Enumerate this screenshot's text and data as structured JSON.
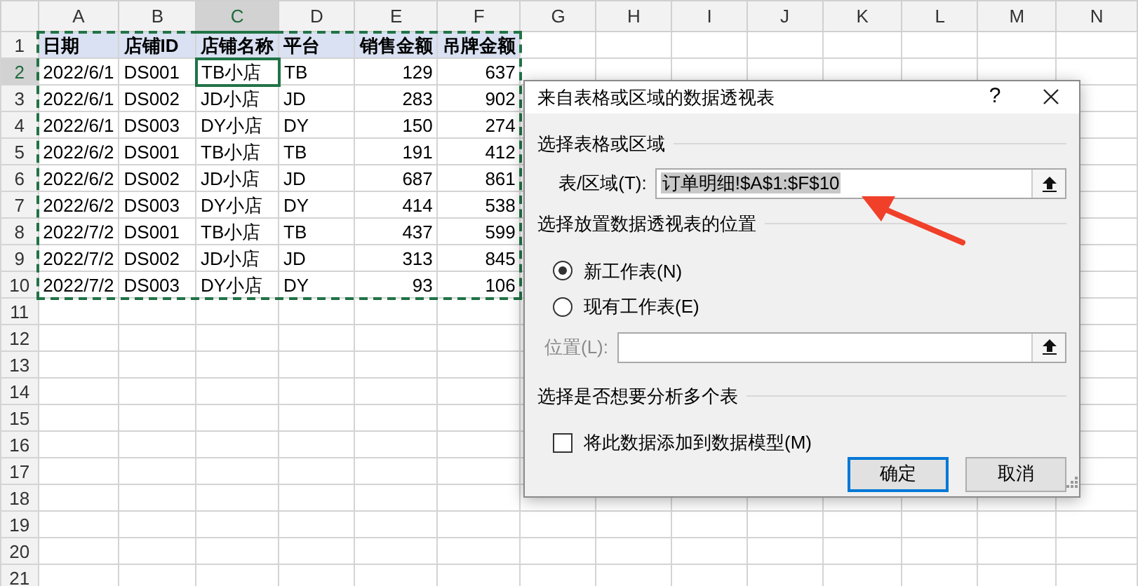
{
  "sheet": {
    "range_marquee": true,
    "columns": [
      {
        "label": "A",
        "kind": "date",
        "selected": false
      },
      {
        "label": "B",
        "kind": "text",
        "selected": false
      },
      {
        "label": "C",
        "kind": "text",
        "selected": true
      },
      {
        "label": "D",
        "kind": "text",
        "selected": false
      },
      {
        "label": "E",
        "kind": "number",
        "selected": false
      },
      {
        "label": "F",
        "kind": "number",
        "selected": false
      },
      {
        "label": "G",
        "selected": false
      },
      {
        "label": "H",
        "selected": false
      },
      {
        "label": "I",
        "selected": false
      },
      {
        "label": "J",
        "selected": false
      },
      {
        "label": "K",
        "selected": false
      },
      {
        "label": "L",
        "selected": false
      },
      {
        "label": "M",
        "selected": false
      },
      {
        "label": "N",
        "selected": false
      }
    ],
    "rows": [
      {
        "label": "1",
        "kind": "header",
        "selected": false,
        "cells": [
          {
            "text": "日期",
            "selected": false
          },
          {
            "text": "店铺ID",
            "selected": false
          },
          {
            "text": "店铺名称",
            "selected": false
          },
          {
            "text": "平台",
            "selected": false
          },
          {
            "text": "销售金额",
            "selected": false
          },
          {
            "text": "吊牌金额",
            "selected": false
          }
        ]
      },
      {
        "label": "2",
        "kind": "data",
        "selected": true,
        "cells": [
          {
            "text": "2022/6/1",
            "selected": false
          },
          {
            "text": "DS001",
            "selected": false
          },
          {
            "text": "TB小店",
            "selected": true
          },
          {
            "text": "TB",
            "selected": false
          },
          {
            "text": "129",
            "selected": false
          },
          {
            "text": "637",
            "selected": false
          }
        ]
      },
      {
        "label": "3",
        "kind": "data",
        "selected": false,
        "cells": [
          {
            "text": "2022/6/1",
            "selected": false
          },
          {
            "text": "DS002",
            "selected": false
          },
          {
            "text": "JD小店",
            "selected": false
          },
          {
            "text": "JD",
            "selected": false
          },
          {
            "text": "283",
            "selected": false
          },
          {
            "text": "902",
            "selected": false
          }
        ]
      },
      {
        "label": "4",
        "kind": "data",
        "selected": false,
        "cells": [
          {
            "text": "2022/6/1",
            "selected": false
          },
          {
            "text": "DS003",
            "selected": false
          },
          {
            "text": "DY小店",
            "selected": false
          },
          {
            "text": "DY",
            "selected": false
          },
          {
            "text": "150",
            "selected": false
          },
          {
            "text": "274",
            "selected": false
          }
        ]
      },
      {
        "label": "5",
        "kind": "data",
        "selected": false,
        "cells": [
          {
            "text": "2022/6/2",
            "selected": false
          },
          {
            "text": "DS001",
            "selected": false
          },
          {
            "text": "TB小店",
            "selected": false
          },
          {
            "text": "TB",
            "selected": false
          },
          {
            "text": "191",
            "selected": false
          },
          {
            "text": "412",
            "selected": false
          }
        ]
      },
      {
        "label": "6",
        "kind": "data",
        "selected": false,
        "cells": [
          {
            "text": "2022/6/2",
            "selected": false
          },
          {
            "text": "DS002",
            "selected": false
          },
          {
            "text": "JD小店",
            "selected": false
          },
          {
            "text": "JD",
            "selected": false
          },
          {
            "text": "687",
            "selected": false
          },
          {
            "text": "861",
            "selected": false
          }
        ]
      },
      {
        "label": "7",
        "kind": "data",
        "selected": false,
        "cells": [
          {
            "text": "2022/6/2",
            "selected": false
          },
          {
            "text": "DS003",
            "selected": false
          },
          {
            "text": "DY小店",
            "selected": false
          },
          {
            "text": "DY",
            "selected": false
          },
          {
            "text": "414",
            "selected": false
          },
          {
            "text": "538",
            "selected": false
          }
        ]
      },
      {
        "label": "8",
        "kind": "data",
        "selected": false,
        "cells": [
          {
            "text": "2022/7/2",
            "selected": false
          },
          {
            "text": "DS001",
            "selected": false
          },
          {
            "text": "TB小店",
            "selected": false
          },
          {
            "text": "TB",
            "selected": false
          },
          {
            "text": "437",
            "selected": false
          },
          {
            "text": "599",
            "selected": false
          }
        ]
      },
      {
        "label": "9",
        "kind": "data",
        "selected": false,
        "cells": [
          {
            "text": "2022/7/2",
            "selected": false
          },
          {
            "text": "DS002",
            "selected": false
          },
          {
            "text": "JD小店",
            "selected": false
          },
          {
            "text": "JD",
            "selected": false
          },
          {
            "text": "313",
            "selected": false
          },
          {
            "text": "845",
            "selected": false
          }
        ]
      },
      {
        "label": "10",
        "kind": "data",
        "selected": false,
        "cells": [
          {
            "text": "2022/7/2",
            "selected": false
          },
          {
            "text": "DS003",
            "selected": false
          },
          {
            "text": "DY小店",
            "selected": false
          },
          {
            "text": "DY",
            "selected": false
          },
          {
            "text": "93",
            "selected": false
          },
          {
            "text": "106",
            "selected": false
          }
        ]
      },
      {
        "label": "11",
        "selected": false
      },
      {
        "label": "12",
        "selected": false
      },
      {
        "label": "13",
        "selected": false
      },
      {
        "label": "14",
        "selected": false
      },
      {
        "label": "15",
        "selected": false
      },
      {
        "label": "16",
        "selected": false
      },
      {
        "label": "17",
        "selected": false
      },
      {
        "label": "18",
        "selected": false
      },
      {
        "label": "19",
        "selected": false
      },
      {
        "label": "20",
        "selected": false
      },
      {
        "label": "21",
        "selected": false
      }
    ]
  },
  "dialog": {
    "title": "来自表格或区域的数据透视表",
    "help_button": "?",
    "source": {
      "heading": "选择表格或区域",
      "field_label": "表/区域(T):",
      "value": "订单明细!$A$1:$F$10",
      "value_selected": true
    },
    "placement": {
      "heading": "选择放置数据透视表的位置",
      "options": [
        {
          "label": "新工作表(N)",
          "selected": true
        },
        {
          "label": "现有工作表(E)",
          "selected": false
        }
      ],
      "location": {
        "label": "位置(L):",
        "disabled": true
      }
    },
    "multi": {
      "heading": "选择是否想要分析多个表",
      "checkbox": {
        "label": "将此数据添加到数据模型(M)",
        "checked": false
      }
    },
    "buttons": [
      {
        "label": "确定",
        "default": true
      },
      {
        "label": "取消",
        "default": false
      }
    ]
  }
}
